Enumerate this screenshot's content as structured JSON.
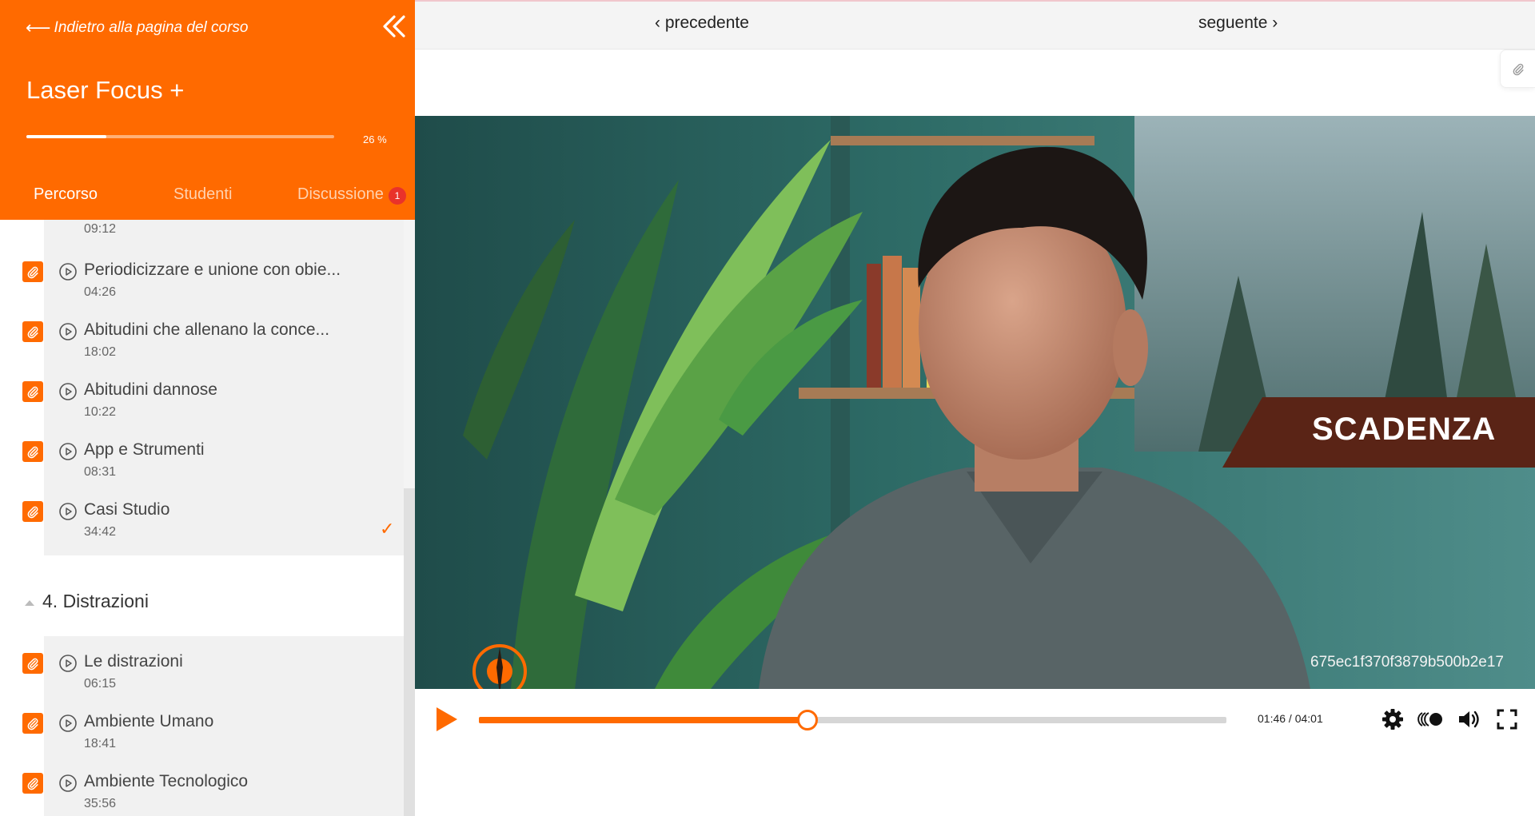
{
  "sidebar": {
    "back_label": "Indietro alla pagina del corso",
    "course_title": "Laser Focus +",
    "progress_percent": 26,
    "progress_text": "26 %",
    "tabs": [
      {
        "label": "Percorso",
        "active": true
      },
      {
        "label": "Studenti",
        "active": false
      },
      {
        "label": "Discussione",
        "active": false,
        "badge": "1"
      }
    ],
    "top_duration": "09:12",
    "lessons_group_a": [
      {
        "title": "Periodicizzare e unione con obie...",
        "duration": "04:26",
        "completed": false
      },
      {
        "title": "Abitudini che allenano la conce...",
        "duration": "18:02",
        "completed": false
      },
      {
        "title": "Abitudini dannose",
        "duration": "10:22",
        "completed": false
      },
      {
        "title": "App e Strumenti",
        "duration": "08:31",
        "completed": false
      },
      {
        "title": "Casi Studio",
        "duration": "34:42",
        "completed": true
      }
    ],
    "section_title": "4. Distrazioni",
    "lessons_group_b": [
      {
        "title": "Le distrazioni",
        "duration": "06:15"
      },
      {
        "title": "Ambiente Umano",
        "duration": "18:41"
      },
      {
        "title": "Ambiente Tecnologico",
        "duration": "35:56"
      }
    ],
    "check_mark": "✓"
  },
  "topbar": {
    "prev_label": "‹ precedente",
    "next_label": "seguente ›"
  },
  "video": {
    "overlay_text": "SCADENZA",
    "hash_text": "675ec1f370f3879b500b2e17",
    "current_time": "01:46",
    "total_time": "04:01",
    "time_display": "01:46 / 04:01",
    "progress_fraction": 0.44
  },
  "colors": {
    "accent": "#ff6a00",
    "badge": "#e9322a",
    "banner": "#5a2416"
  },
  "icons": {
    "back": "arrow-left-icon",
    "collapse": "double-chevron-left-icon",
    "attachment": "paperclip-icon",
    "play": "play-circle-icon",
    "settings": "gear-icon",
    "speed": "playback-speed-icon",
    "volume": "volume-icon",
    "fullscreen": "fullscreen-icon"
  }
}
